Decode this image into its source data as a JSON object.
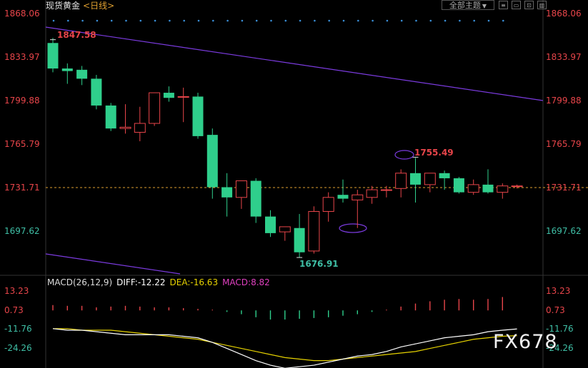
{
  "header": {
    "title": "现货黄金",
    "period": "<日线>",
    "theme_button": "全部主题",
    "tools": [
      "≡",
      "▭",
      "⊡",
      "▥"
    ]
  },
  "colors": {
    "up": "#e8454a",
    "down": "#2fcf8c",
    "trendline": "#7b3bdf",
    "diff": "#ffffff",
    "dea": "#e6d200",
    "background": "#000000"
  },
  "price_axis": {
    "ticks": [
      "1868.06",
      "1833.97",
      "1799.88",
      "1765.79",
      "1731.71",
      "1697.62"
    ]
  },
  "annotations": {
    "high": "1847.58",
    "low": "1676.91",
    "marked_high": "1755.49"
  },
  "macd": {
    "label": "MACD(26,12,9)",
    "diff": "DIFF:-12.22",
    "dea": "DEA:-16.63",
    "macd": "MACD:8.82",
    "ticks": [
      "13.23",
      "0.73",
      "-11.76",
      "-24.26"
    ]
  },
  "watermark": "FX678",
  "chart_data": {
    "type": "candlestick",
    "yrange": [
      1676.91,
      1868.06
    ],
    "candles": [
      {
        "o": 1845,
        "h": 1849,
        "l": 1822,
        "c": 1825
      },
      {
        "o": 1825,
        "h": 1829,
        "l": 1813,
        "c": 1823
      },
      {
        "o": 1824,
        "h": 1827,
        "l": 1812,
        "c": 1817
      },
      {
        "o": 1817,
        "h": 1820,
        "l": 1793,
        "c": 1796
      },
      {
        "o": 1796,
        "h": 1798,
        "l": 1776,
        "c": 1778
      },
      {
        "o": 1778,
        "h": 1797,
        "l": 1774,
        "c": 1779
      },
      {
        "o": 1775,
        "h": 1795,
        "l": 1768,
        "c": 1782
      },
      {
        "o": 1782,
        "h": 1806,
        "l": 1780,
        "c": 1806
      },
      {
        "o": 1806,
        "h": 1811,
        "l": 1799,
        "c": 1802
      },
      {
        "o": 1803,
        "h": 1810,
        "l": 1783,
        "c": 1803
      },
      {
        "o": 1803,
        "h": 1806,
        "l": 1770,
        "c": 1772
      },
      {
        "o": 1773,
        "h": 1778,
        "l": 1723,
        "c": 1732
      },
      {
        "o": 1732,
        "h": 1743,
        "l": 1709,
        "c": 1724
      },
      {
        "o": 1724,
        "h": 1737,
        "l": 1715,
        "c": 1737
      },
      {
        "o": 1737,
        "h": 1739,
        "l": 1704,
        "c": 1709
      },
      {
        "o": 1709,
        "h": 1714,
        "l": 1693,
        "c": 1696
      },
      {
        "o": 1697,
        "h": 1701,
        "l": 1690,
        "c": 1701
      },
      {
        "o": 1700,
        "h": 1711,
        "l": 1677,
        "c": 1681
      },
      {
        "o": 1682,
        "h": 1717,
        "l": 1680,
        "c": 1713
      },
      {
        "o": 1713,
        "h": 1728,
        "l": 1705,
        "c": 1724
      },
      {
        "o": 1726,
        "h": 1738,
        "l": 1720,
        "c": 1723
      },
      {
        "o": 1722,
        "h": 1730,
        "l": 1700,
        "c": 1726
      },
      {
        "o": 1724,
        "h": 1733,
        "l": 1719,
        "c": 1730
      },
      {
        "o": 1730,
        "h": 1733,
        "l": 1724,
        "c": 1730
      },
      {
        "o": 1731,
        "h": 1746,
        "l": 1724,
        "c": 1743
      },
      {
        "o": 1743,
        "h": 1755,
        "l": 1720,
        "c": 1734
      },
      {
        "o": 1734,
        "h": 1743,
        "l": 1728,
        "c": 1743
      },
      {
        "o": 1743,
        "h": 1745,
        "l": 1730,
        "c": 1739
      },
      {
        "o": 1739,
        "h": 1740,
        "l": 1727,
        "c": 1728
      },
      {
        "o": 1728,
        "h": 1738,
        "l": 1726,
        "c": 1734
      },
      {
        "o": 1734,
        "h": 1746,
        "l": 1727,
        "c": 1728
      },
      {
        "o": 1728,
        "h": 1735,
        "l": 1723,
        "c": 1733
      },
      {
        "o": 1733,
        "h": 1734,
        "l": 1731,
        "c": 1733
      }
    ],
    "macd_hist": [
      3.5,
      3,
      3,
      2,
      2.5,
      3,
      2.5,
      2,
      2,
      1.5,
      1,
      0.5,
      -1,
      -2.5,
      -4.5,
      -6,
      -6,
      -5.5,
      -5,
      -4.5,
      -3.5,
      -2.5,
      -1,
      0.5,
      2.5,
      4.5,
      6,
      7,
      7.5,
      7,
      7.5,
      8.8
    ],
    "diff_line": [
      -12,
      -13,
      -13,
      -14,
      -15,
      -16,
      -16,
      -16,
      -16,
      -17,
      -18,
      -21,
      -25,
      -29,
      -33,
      -36,
      -38,
      -37,
      -36,
      -34,
      -32,
      -30,
      -29,
      -27,
      -24,
      -22,
      -20,
      -18,
      -17,
      -16,
      -14,
      -13,
      -12.2
    ],
    "dea_line": [
      -12,
      -12,
      -13,
      -13,
      -13,
      -14,
      -15,
      -16,
      -17,
      -18,
      -19,
      -21,
      -23,
      -25,
      -27,
      -29,
      -31,
      -32,
      -33,
      -33,
      -32,
      -31,
      -30,
      -29,
      -28,
      -27,
      -25,
      -23,
      -21,
      -19,
      -18,
      -17,
      -16.6
    ]
  }
}
